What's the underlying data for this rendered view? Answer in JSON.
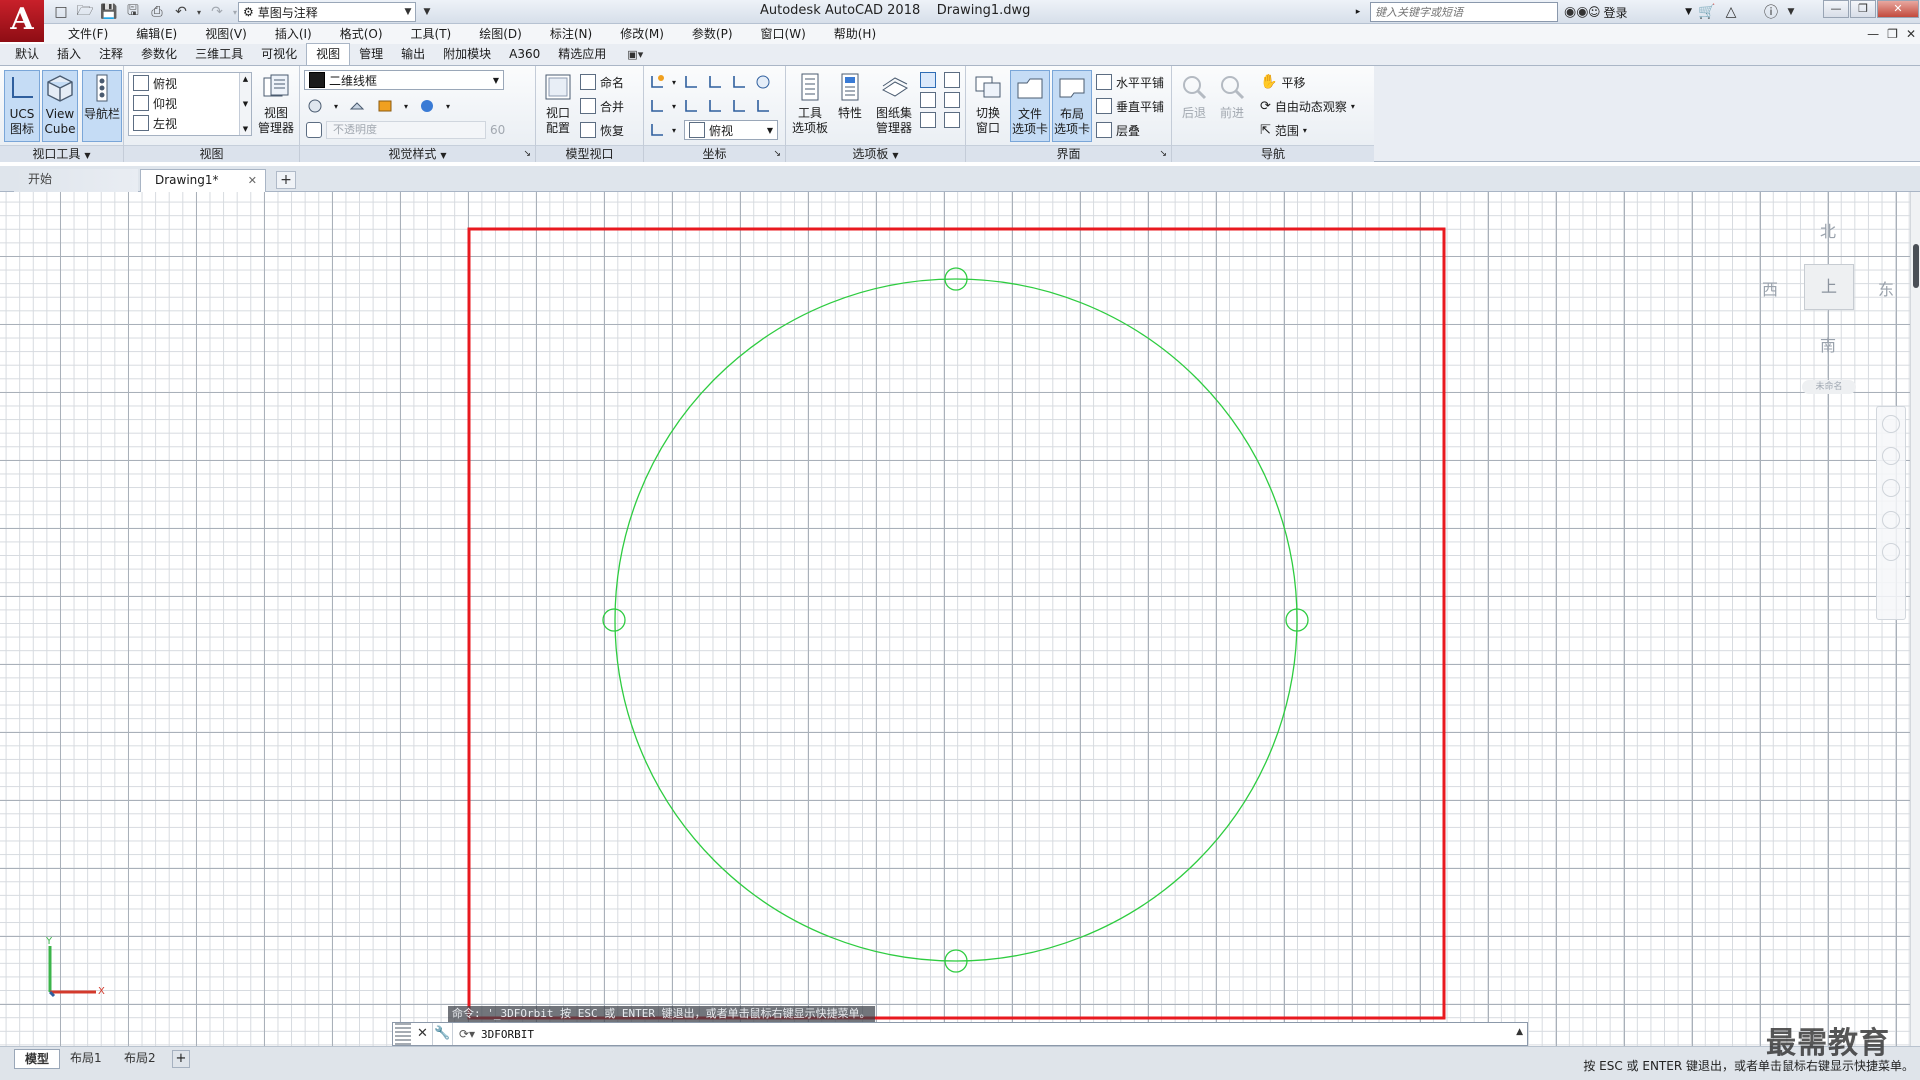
{
  "app": {
    "logo_letter": "A",
    "window_title": "Autodesk AutoCAD 2018    Drawing1.dwg",
    "workspace": "草图与注释",
    "help_search_placeholder": "键入关键字或短语",
    "signin_label": "登录"
  },
  "menubar": {
    "items": [
      "文件(F)",
      "编辑(E)",
      "视图(V)",
      "插入(I)",
      "格式(O)",
      "工具(T)",
      "绘图(D)",
      "标注(N)",
      "修改(M)",
      "参数(P)",
      "窗口(W)",
      "帮助(H)"
    ]
  },
  "ribbon_tabs": {
    "items": [
      "默认",
      "插入",
      "注释",
      "参数化",
      "三维工具",
      "可视化",
      "视图",
      "管理",
      "输出",
      "附加模块",
      "A360",
      "精选应用"
    ],
    "active_index": 6
  },
  "ribbon": {
    "viewport_tools": {
      "title": "视口工具",
      "ucs_icon": "UCS\n图标",
      "viewcube": "View\nCube",
      "navbar": "导航栏"
    },
    "views": {
      "title": "视图",
      "items": [
        "俯视",
        "仰视",
        "左视"
      ],
      "manager": "视图\n管理器"
    },
    "visual_styles": {
      "title": "视觉样式",
      "current": "二维线框",
      "opacity_label": "不透明度",
      "opacity_value": "60"
    },
    "model_viewports": {
      "title": "模型视口",
      "config": "视口\n配置",
      "named": "命名",
      "join": "合并",
      "restore": "恢复"
    },
    "coordinates": {
      "title": "坐标",
      "view_combo": "俯视"
    },
    "palettes": {
      "title": "选项板",
      "tool_palettes": "工具\n选项板",
      "properties": "特性",
      "sheet_set": "图纸集\n管理器"
    },
    "interface": {
      "title": "界面",
      "switch_windows": "切换\n窗口",
      "file_tabs": "文件\n选项卡",
      "layout_tabs": "布局\n选项卡",
      "tile_h": "水平平铺",
      "tile_v": "垂直平铺",
      "cascade": "层叠"
    },
    "navigate": {
      "title": "导航",
      "back": "后退",
      "forward": "前进",
      "pan": "平移",
      "orbit": "自由动态观察",
      "extents": "范围"
    }
  },
  "file_tabs": {
    "start": "开始",
    "drawing": "Drawing1*"
  },
  "viewcube": {
    "north": "北",
    "south": "南",
    "east": "东",
    "west": "西",
    "face": "上",
    "wcs": "未命名"
  },
  "ucs": {
    "x": "X",
    "y": "Y"
  },
  "command": {
    "history": "命令: '_3DFOrbit 按 ESC 或 ENTER 键退出，或者单击鼠标右键显示快捷菜单。",
    "input": "3DFORBIT"
  },
  "layout_tabs": [
    "模型",
    "布局1",
    "布局2"
  ],
  "status": {
    "hint": "按 ESC 或 ENTER 键退出，或者单击鼠标右键显示快捷菜单。"
  },
  "watermark": "最需教育",
  "colors": {
    "circle": "#2ecc40",
    "selection_rect": "#e8191f",
    "grid_major": "#a9b0b9",
    "grid_minor": "#d6dadf"
  }
}
